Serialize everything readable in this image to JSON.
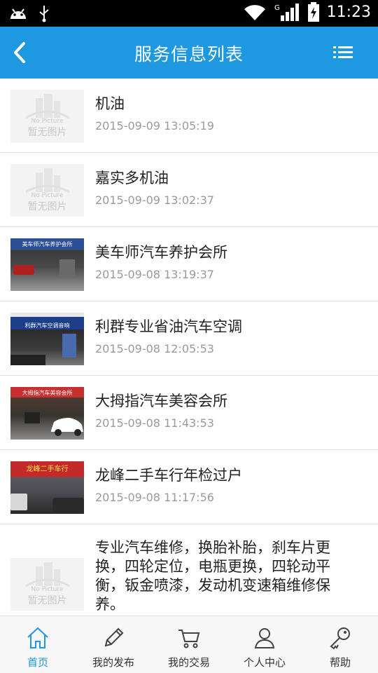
{
  "status_bar": {
    "time": "11:23",
    "network": "G"
  },
  "header": {
    "title": "服务信息列表",
    "back_icon": "chevron-left-icon",
    "menu_icon": "list-menu-icon",
    "color": "#1e98e0"
  },
  "placeholder": {
    "en": "No Picture",
    "cn": "暂无图片"
  },
  "items": [
    {
      "name": "机油",
      "time": "2015-09-09 13:05:19",
      "image": "placeholder"
    },
    {
      "name": "嘉实多机油",
      "time": "2015-09-09 13:02:37",
      "image": "placeholder"
    },
    {
      "name": "美车师汽车养护会所",
      "time": "2015-09-08 13:19:37",
      "image": "photo",
      "sign": "美车师汽车养护会所"
    },
    {
      "name": "利群专业省油汽车空调",
      "time": "2015-09-08 12:05:53",
      "image": "photo",
      "sign": "利群汽车空调音响"
    },
    {
      "name": "大拇指汽车美容会所",
      "time": "2015-09-08 11:43:53",
      "image": "photo",
      "sign": "大拇指汽车美容会所"
    },
    {
      "name": "龙峰二手车行年检过户",
      "time": "2015-09-08 11:17:56",
      "image": "photo",
      "sign": "龙峰二手车行"
    },
    {
      "name": "专业汽车维修，换胎补胎，刹车片更换，四轮定位，电瓶更换，四轮动平衡，钣金喷漆，发动机变速箱维修保养。",
      "image": "placeholder"
    }
  ],
  "nav": [
    {
      "label": "首页",
      "icon": "home-icon",
      "active": true
    },
    {
      "label": "我的发布",
      "icon": "pencil-icon",
      "active": false
    },
    {
      "label": "我的交易",
      "icon": "cart-icon",
      "active": false
    },
    {
      "label": "个人中心",
      "icon": "user-icon",
      "active": false
    },
    {
      "label": "帮助",
      "icon": "key-icon",
      "active": false
    }
  ]
}
